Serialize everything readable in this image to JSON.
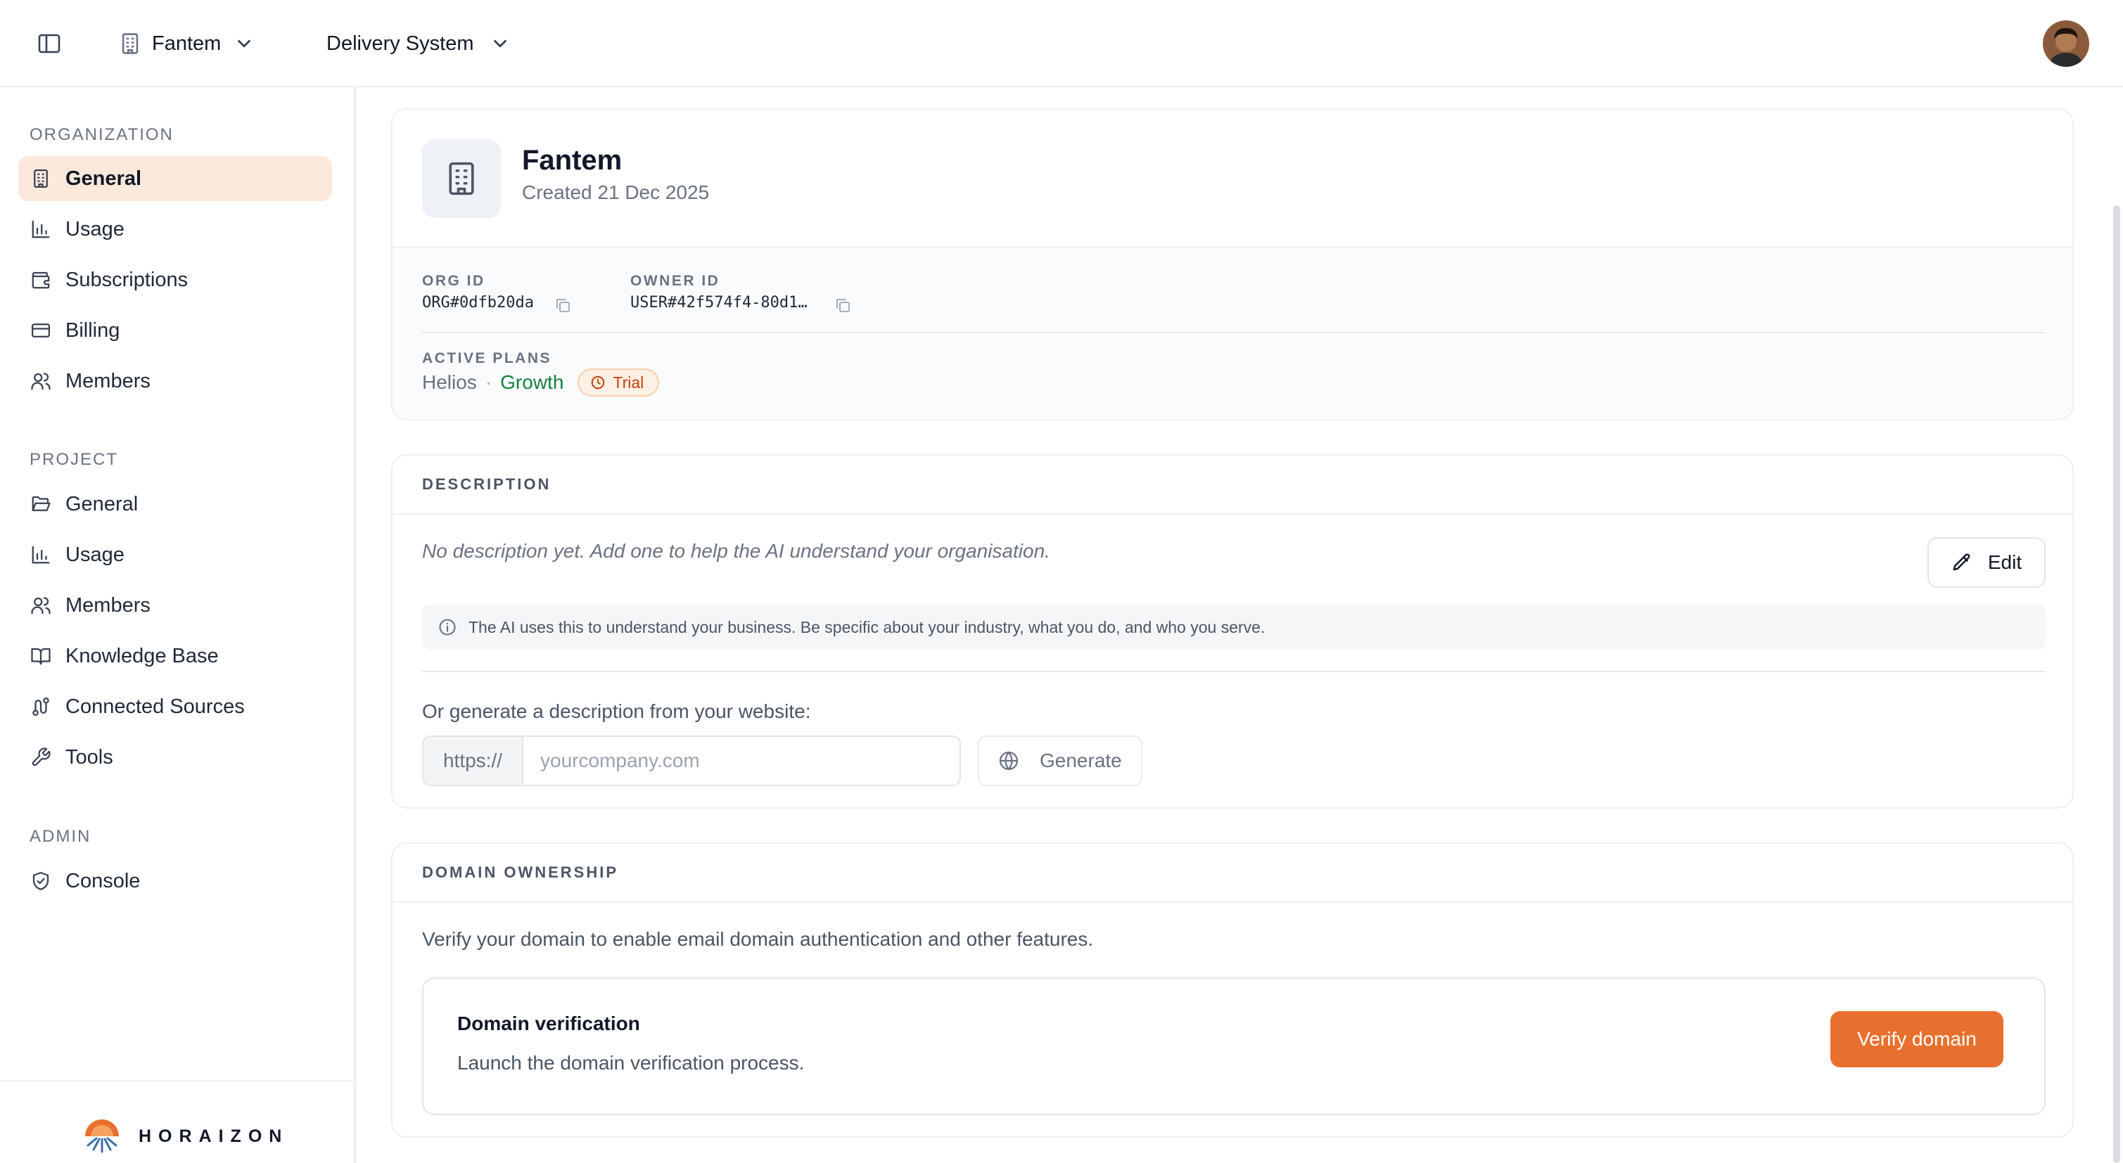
{
  "header": {
    "org_selector": "Fantem",
    "project_selector": "Delivery System"
  },
  "sidebar": {
    "sections": [
      {
        "title": "ORGANIZATION",
        "items": [
          "General",
          "Usage",
          "Subscriptions",
          "Billing",
          "Members"
        ]
      },
      {
        "title": "PROJECT",
        "items": [
          "General",
          "Usage",
          "Members",
          "Knowledge Base",
          "Connected Sources",
          "Tools"
        ]
      },
      {
        "title": "ADMIN",
        "items": [
          "Console"
        ]
      }
    ],
    "active_item": "ORGANIZATION / General",
    "brand": "HORAIZON"
  },
  "org_card": {
    "name": "Fantem",
    "created": "Created 21 Dec 2025",
    "org_id_label": "ORG ID",
    "org_id": "ORG#0dfb20da",
    "owner_id_label": "OWNER ID",
    "owner_id": "USER#42f574f4-80d1…",
    "active_plans_label": "ACTIVE PLANS",
    "plan_product": "Helios",
    "plan_separator": "·",
    "plan_tier": "Growth",
    "plan_status": "Trial"
  },
  "description_card": {
    "title": "DESCRIPTION",
    "empty_text": "No description yet. Add one to help the AI understand your organisation.",
    "edit_label": "Edit",
    "hint": "The AI uses this to understand your business. Be specific about your industry, what you do, and who you serve.",
    "generate_label": "Or generate a description from your website:",
    "url_prefix": "https://",
    "url_placeholder": "yourcompany.com",
    "url_value": "",
    "generate_button": "Generate"
  },
  "domain_card": {
    "title": "DOMAIN OWNERSHIP",
    "description": "Verify your domain to enable email domain authentication and other features.",
    "box_title": "Domain verification",
    "box_subtitle": "Launch the domain verification process.",
    "verify_button": "Verify domain"
  },
  "colors": {
    "accent": "#e8702e",
    "active_nav_bg": "#fde9dc",
    "growth_green": "#15803d",
    "trial_orange": "#c2410c"
  }
}
